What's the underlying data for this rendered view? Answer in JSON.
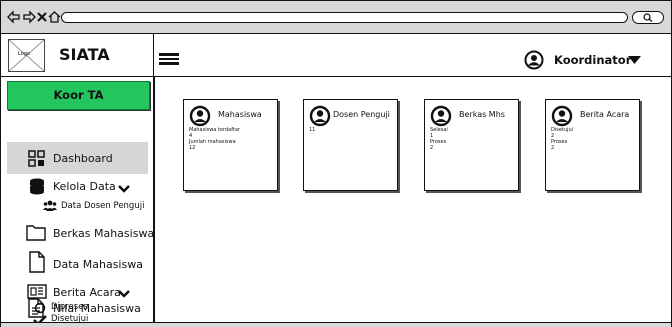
{
  "browser": {
    "icons": [
      "back-arrow-icon",
      "forward-arrow-icon",
      "close-icon",
      "home-icon",
      "search-icon"
    ]
  },
  "sidebar": {
    "logo_text": "Logo",
    "app_title": "SIATA",
    "role_button": "Koor TA",
    "items": [
      {
        "label": "Dashboard",
        "icon": "dashboard-icon"
      },
      {
        "label": "Kelola Data",
        "icon": "database-icon"
      },
      {
        "label": "Data Dosen Penguji",
        "icon": "users-icon"
      },
      {
        "label": "Berkas Mahasiswa",
        "icon": "folder-icon"
      },
      {
        "label": "Data Mahasiswa",
        "icon": "file-icon"
      },
      {
        "label": "Berita Acara",
        "icon": "newspaper-icon"
      },
      {
        "label": "Diproses",
        "icon": "circle-icon"
      },
      {
        "label": "Disetujui",
        "icon": "check-icon"
      },
      {
        "label": "Nilai Mahasiswa",
        "icon": "document-icon"
      }
    ]
  },
  "header": {
    "user_label": "Koordinator"
  },
  "cards": [
    {
      "title": "Mahasiswa",
      "lines": [
        "Mahasiswa terdaftar",
        "4",
        "Jumlah mahasiswa",
        "12"
      ]
    },
    {
      "title": "Dosen Penguji",
      "lines": [
        "11"
      ]
    },
    {
      "title": "Berkas Mhs",
      "lines": [
        "Selesai",
        "1",
        "Proses",
        "2"
      ]
    },
    {
      "title": "Berita Acara",
      "lines": [
        "Disetujui",
        "2",
        "Proses",
        "2"
      ]
    }
  ]
}
